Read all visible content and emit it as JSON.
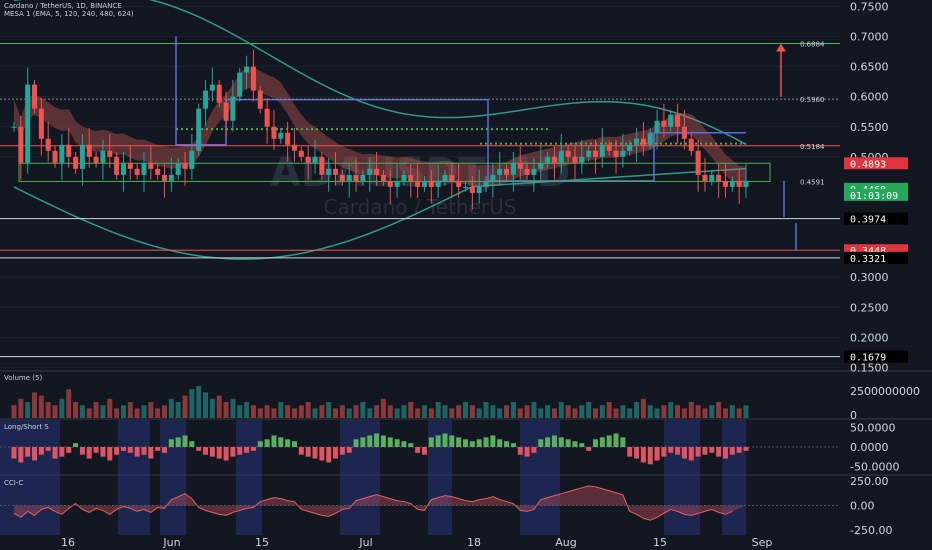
{
  "header": {
    "symbol_line": "Cardano / TetherUS, 1D, BINANCE",
    "indicator_line": "MESA 1 (EMA, 5, 120, 240, 480, 624)"
  },
  "watermark": {
    "ticker": "ADAUSDT, 1D",
    "name": "Cardano / TetherUS"
  },
  "colors": {
    "background": "#131722",
    "bull": "#26a69a",
    "bear": "#ef5350",
    "price_axis": "#d1d4dc",
    "ribbon": "#e0605a",
    "band": "#2e9b8a",
    "rect": "#5b6ee1"
  },
  "chart_data": [
    {
      "type": "candlestick",
      "panel": "price",
      "x_ticks": [
        "16",
        "Jun",
        "15",
        "Jul",
        "18",
        "Aug",
        "15",
        "Sep"
      ],
      "y_ticks": [
        "0.7500",
        "0.7000",
        "0.6500",
        "0.6000",
        "0.5500",
        "0.5000",
        "0.3000",
        "0.2500",
        "0.2000",
        "0.1500"
      ],
      "ylim": [
        0.15,
        0.76
      ],
      "series": [
        {
          "values": [
            0.55,
            0.49,
            0.62,
            0.58,
            0.53,
            0.51,
            0.49,
            0.52,
            0.5,
            0.48,
            0.52,
            0.5,
            0.49,
            0.51,
            0.5,
            0.47,
            0.49,
            0.48,
            0.47,
            0.49,
            0.48,
            0.47,
            0.46,
            0.47,
            0.49,
            0.48,
            0.51,
            0.58,
            0.61,
            0.62,
            0.59,
            0.56,
            0.6,
            0.64,
            0.65,
            0.61,
            0.58,
            0.55,
            0.53,
            0.54,
            0.52,
            0.51,
            0.5,
            0.49,
            0.5,
            0.47,
            0.48,
            0.47,
            0.46,
            0.47,
            0.46,
            0.47,
            0.48,
            0.47,
            0.46,
            0.45,
            0.46,
            0.47,
            0.46,
            0.45,
            0.46,
            0.45,
            0.46,
            0.47,
            0.46,
            0.45,
            0.45,
            0.44,
            0.45,
            0.46,
            0.47,
            0.48,
            0.47,
            0.49,
            0.48,
            0.47,
            0.48,
            0.49,
            0.5,
            0.49,
            0.51,
            0.5,
            0.49,
            0.5,
            0.51,
            0.5,
            0.52,
            0.51,
            0.5,
            0.51,
            0.52,
            0.53,
            0.52,
            0.54,
            0.56,
            0.55,
            0.57,
            0.55,
            0.53,
            0.51,
            0.47,
            0.46,
            0.47,
            0.46,
            0.45,
            0.46,
            0.45,
            0.46
          ]
        }
      ],
      "price_labels": [
        {
          "text": "0.6884",
          "value": 0.6884,
          "style": "plain"
        },
        {
          "text": "0.5960",
          "value": 0.596,
          "style": "plain"
        },
        {
          "text": "0.5184",
          "value": 0.5184,
          "style": "plain"
        },
        {
          "text": "0.4893",
          "value": 0.4893,
          "style": "red"
        },
        {
          "text": "0.4591",
          "value": 0.4591,
          "style": "plain"
        },
        {
          "text": "0.4468",
          "value": 0.4468,
          "style": "green"
        },
        {
          "text": "01:03:09",
          "value": 0.4368,
          "style": "green"
        },
        {
          "text": "0.3974",
          "value": 0.3974,
          "style": "black"
        },
        {
          "text": "0.3448",
          "value": 0.3448,
          "style": "red"
        },
        {
          "text": "0.3321",
          "value": 0.3321,
          "style": "black"
        },
        {
          "text": "0.1679",
          "value": 0.1679,
          "style": "black"
        }
      ]
    },
    {
      "type": "bar",
      "panel": "volume",
      "title": "Volume (5)",
      "y_ticks": [
        "2500000000",
        "0"
      ],
      "values": [
        0.4,
        0.6,
        0.5,
        0.8,
        0.7,
        0.5,
        0.4,
        0.6,
        0.9,
        0.5,
        0.4,
        0.3,
        0.5,
        0.4,
        0.6,
        0.3,
        0.4,
        0.5,
        0.3,
        0.4,
        0.5,
        0.3,
        0.4,
        0.6,
        0.5,
        0.7,
        0.9,
        1.0,
        0.8,
        0.6,
        0.7,
        0.5,
        0.6,
        0.4,
        0.5,
        0.4,
        0.3,
        0.4,
        0.3,
        0.5,
        0.4,
        0.3,
        0.4,
        0.5,
        0.3,
        0.4,
        0.5,
        0.3,
        0.4,
        0.3,
        0.4,
        0.5,
        0.3,
        0.4,
        0.6,
        0.4,
        0.3,
        0.4,
        0.5,
        0.3,
        0.4,
        0.3,
        0.5,
        0.4,
        0.3,
        0.4,
        0.5,
        0.4,
        0.3,
        0.5,
        0.4,
        0.3,
        0.4,
        0.5,
        0.3,
        0.4,
        0.5,
        0.3,
        0.4,
        0.3,
        0.5,
        0.4,
        0.3,
        0.4,
        0.5,
        0.3,
        0.4,
        0.5,
        0.3,
        0.4,
        0.3,
        0.5,
        0.6,
        0.4,
        0.3,
        0.4,
        0.5,
        0.4,
        0.3,
        0.5,
        0.4,
        0.3,
        0.4,
        0.5,
        0.3,
        0.4,
        0.3,
        0.4
      ]
    },
    {
      "type": "bar",
      "panel": "longshort",
      "title": "Long/Short S",
      "y_ticks": [
        "50.0000",
        "0.0000",
        "-50.0000"
      ],
      "ylim": [
        -70,
        70
      ],
      "values": [
        -30,
        -40,
        -25,
        -35,
        -20,
        -10,
        -30,
        -25,
        -15,
        10,
        -20,
        -30,
        -15,
        -25,
        -35,
        -20,
        -10,
        -15,
        -25,
        -20,
        -30,
        -10,
        -15,
        20,
        25,
        30,
        15,
        -10,
        -20,
        -25,
        -30,
        -35,
        -25,
        -20,
        -15,
        -10,
        15,
        20,
        30,
        25,
        20,
        15,
        -20,
        -25,
        -30,
        -35,
        -40,
        -30,
        -20,
        -15,
        20,
        25,
        30,
        35,
        30,
        25,
        20,
        15,
        10,
        -15,
        -20,
        25,
        30,
        35,
        30,
        25,
        20,
        15,
        20,
        25,
        30,
        20,
        15,
        10,
        -20,
        -25,
        -15,
        20,
        25,
        30,
        25,
        20,
        15,
        10,
        -10,
        20,
        25,
        30,
        35,
        25,
        -25,
        -30,
        -40,
        -45,
        -35,
        -25,
        -15,
        -20,
        -30,
        -35,
        -25,
        -20,
        -15,
        -25,
        -30,
        -20,
        -15,
        -10
      ]
    },
    {
      "type": "area",
      "panel": "cci",
      "title": "CCI-C",
      "y_ticks": [
        "250.00",
        "0.00",
        "-250.00"
      ],
      "ylim": [
        -300,
        300
      ],
      "values": [
        -80,
        -120,
        -60,
        -100,
        -40,
        -20,
        -60,
        -90,
        -30,
        20,
        -40,
        -70,
        -30,
        -50,
        -90,
        -40,
        -10,
        -30,
        -60,
        -40,
        -70,
        -20,
        -30,
        60,
        90,
        120,
        70,
        -20,
        -50,
        -70,
        -90,
        -100,
        -70,
        -50,
        -30,
        -20,
        40,
        60,
        80,
        70,
        50,
        40,
        -40,
        -60,
        -80,
        -100,
        -110,
        -80,
        -40,
        -30,
        50,
        70,
        90,
        110,
        90,
        70,
        50,
        40,
        20,
        -40,
        -50,
        60,
        80,
        100,
        90,
        70,
        50,
        40,
        60,
        70,
        90,
        60,
        40,
        20,
        -50,
        -60,
        -40,
        60,
        80,
        100,
        120,
        140,
        160,
        180,
        200,
        190,
        170,
        150,
        130,
        110,
        -60,
        -90,
        -130,
        -150,
        -120,
        -80,
        -40,
        -60,
        -90,
        -100,
        -80,
        -60,
        -40,
        -70,
        -90,
        -60
      ]
    }
  ]
}
